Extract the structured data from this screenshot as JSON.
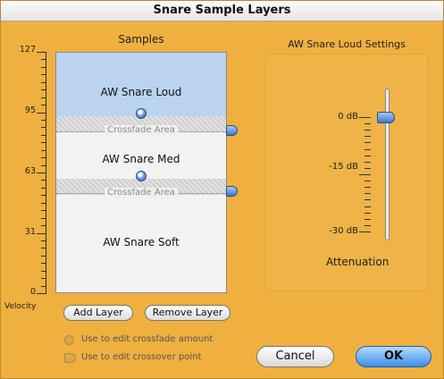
{
  "window": {
    "title": "Snare Sample Layers"
  },
  "samples": {
    "title": "Samples",
    "axis_ticks": [
      "127",
      "95",
      "63",
      "31",
      "0"
    ],
    "axis_label": "Velocity",
    "layers": [
      {
        "name": "AW Snare Loud"
      },
      {
        "name": "AW Snare Med"
      },
      {
        "name": "AW Snare Soft"
      }
    ],
    "crossfade_label": "Crossfade Area",
    "crossfade_label_2": "Crossfade Area"
  },
  "buttons": {
    "add_layer": "Add Layer",
    "remove_layer": "Remove Layer",
    "cancel": "Cancel",
    "ok": "OK"
  },
  "legend": {
    "crossfade": "Use to edit crossfade amount",
    "crossover": "Use to edit crossover point"
  },
  "settings": {
    "title": "AW Snare Loud Settings",
    "attenuation_label": "Attenuation",
    "scale": [
      "0 dB",
      "-15 dB",
      "-30 dB"
    ],
    "attenuation_value_db": 0
  },
  "colors": {
    "background": "#efb040",
    "selected_layer": "#bcd3f0",
    "default_button": "#3b8ee8"
  }
}
